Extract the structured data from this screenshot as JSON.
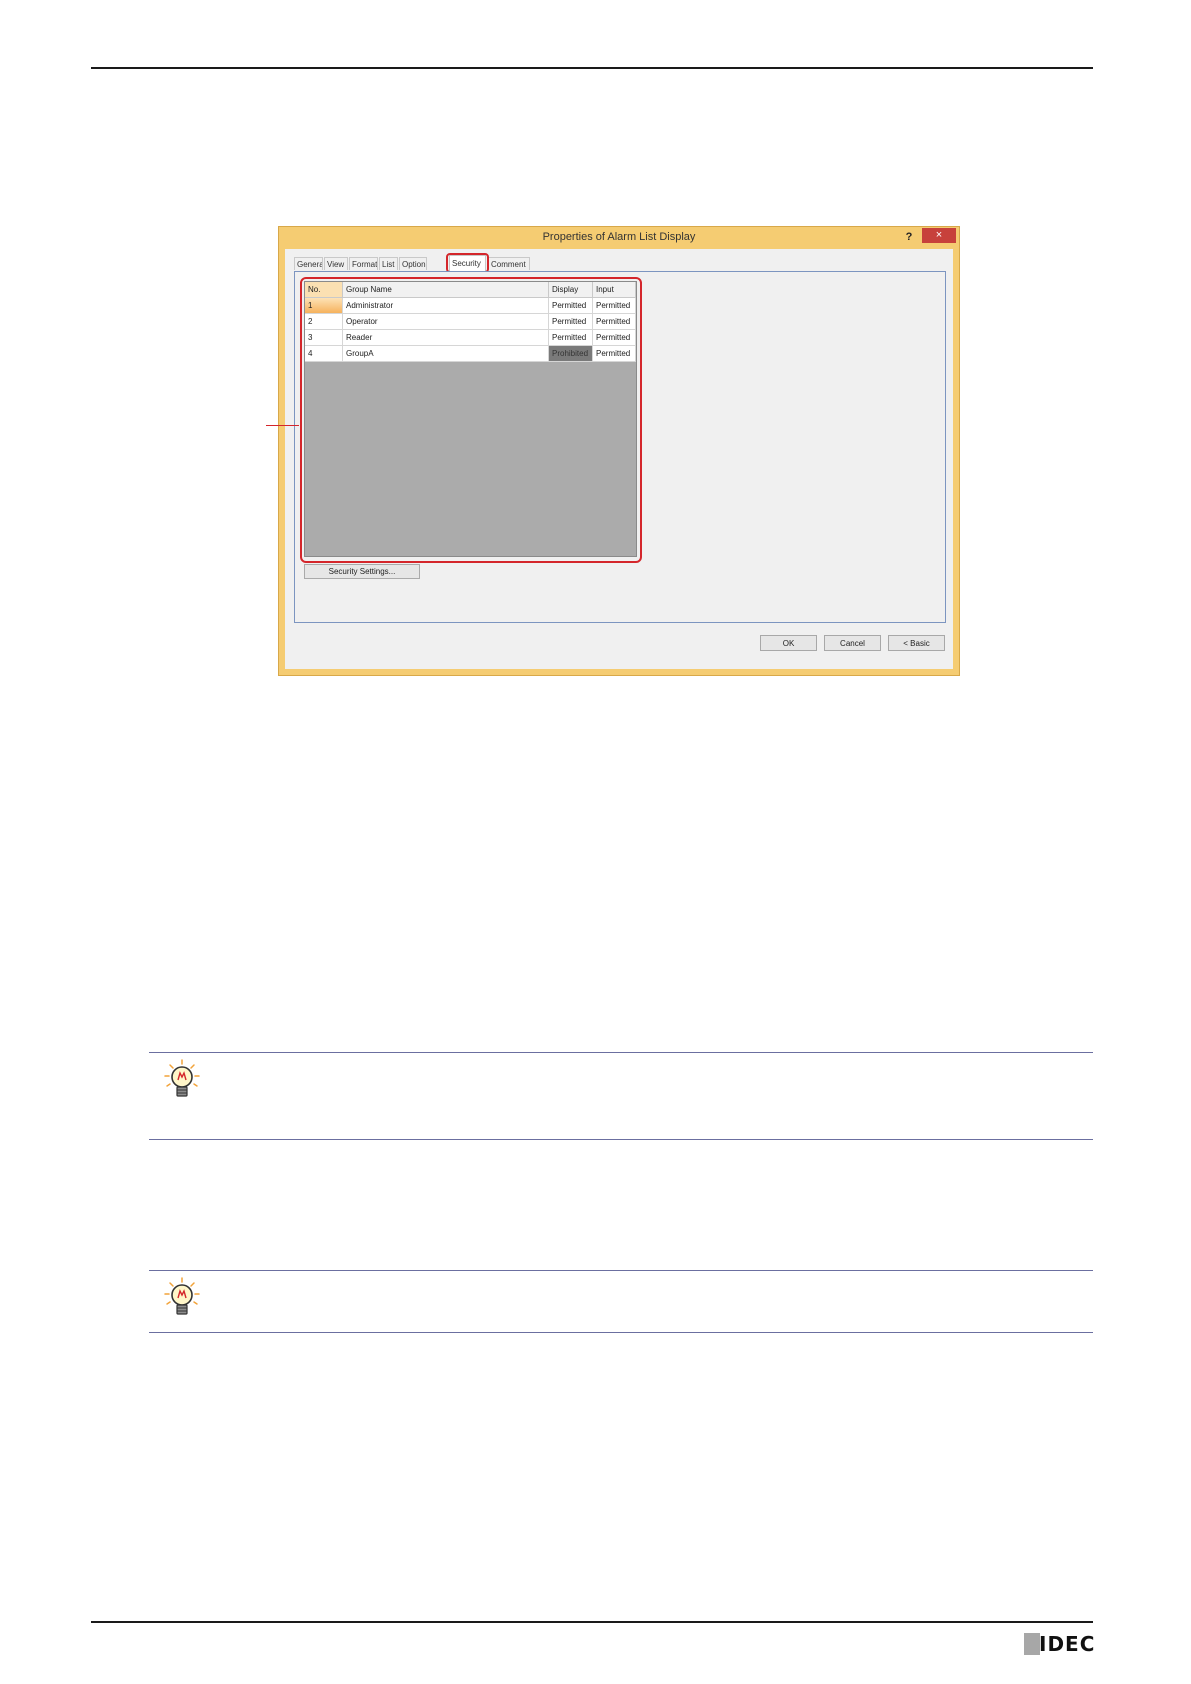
{
  "dialog": {
    "title": "Properties of Alarm List Display",
    "help_label": "?",
    "close_label": "×",
    "tabs": [
      {
        "label": "General"
      },
      {
        "label": "View"
      },
      {
        "label": "Format"
      },
      {
        "label": "List"
      },
      {
        "label": "Option"
      },
      {
        "label": "Security"
      },
      {
        "label": "Comment"
      }
    ],
    "active_tab": "Security",
    "grid": {
      "columns": [
        "No.",
        "Group Name",
        "Display",
        "Input"
      ],
      "rows": [
        {
          "no": "1",
          "name": "Administrator",
          "display": "Permitted",
          "input": "Permitted"
        },
        {
          "no": "2",
          "name": "Operator",
          "display": "Permitted",
          "input": "Permitted"
        },
        {
          "no": "3",
          "name": "Reader",
          "display": "Permitted",
          "input": "Permitted"
        },
        {
          "no": "4",
          "name": "GroupA",
          "display": "Prohibited",
          "input": "Permitted"
        }
      ]
    },
    "security_settings_label": "Security Settings...",
    "ok_label": "OK",
    "cancel_label": "Cancel",
    "basic_label": "< Basic"
  },
  "colors": {
    "frame": "#f5cc72",
    "highlight": "#d4262b",
    "close": "#c7413b",
    "tip_rule": "#6b6fa0"
  },
  "footer": {
    "logo_text": "IDEC"
  }
}
